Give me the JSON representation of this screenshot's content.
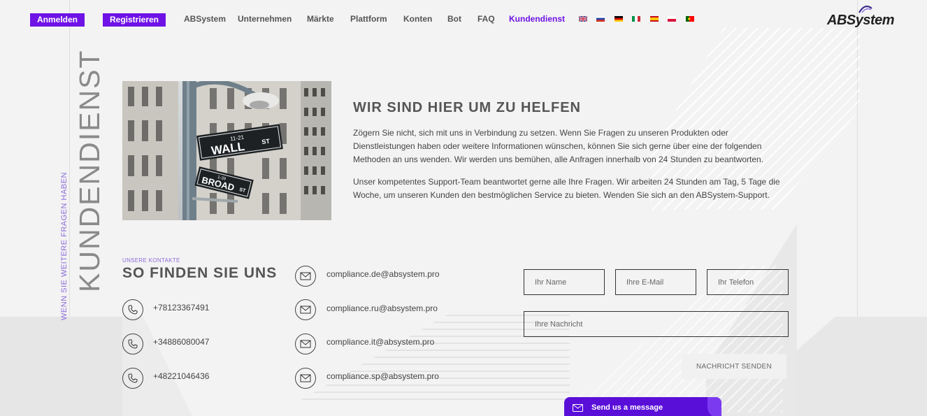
{
  "nav": {
    "login_label": "Anmelden",
    "register_label": "Registrieren",
    "links": [
      "ABSystem",
      "Unternehmen",
      "Märkte",
      "Plattform",
      "Konten",
      "Bot",
      "FAQ",
      "Kundendienst"
    ],
    "active_link": "Kundendienst",
    "languages": [
      "en",
      "ru",
      "de",
      "it",
      "es",
      "pl",
      "pt"
    ]
  },
  "logo": {
    "text": "ABSystem"
  },
  "side": {
    "title": "KUNDENDIENST",
    "subtitle": "WENN SIE WEITERE FRAGEN HABEN"
  },
  "photo": {
    "sign_top": "WALL",
    "sign_top_small": "11-21",
    "sign_st": "ST",
    "sign_bottom": "BROAD",
    "sign_bottom_small": "1-39",
    "sign_bottom_st": "ST"
  },
  "intro": {
    "title": "WIR SIND HIER UM ZU HELFEN",
    "p1": "Zögern Sie nicht, sich mit uns in Verbindung zu setzen. Wenn Sie Fragen zu unseren Produkten oder Dienstleistungen haben oder weitere Informationen wünschen, können Sie sich gerne über eine der folgenden Methoden an uns wenden. Wir werden uns bemühen, alle Anfragen innerhalb von 24 Stunden zu beantworten.",
    "p2": "Unser kompetentes Support-Team beantwortet gerne alle Ihre Fragen. Wir arbeiten 24 Stunden am Tag, 5 Tage die Woche, um unseren Kunden den bestmöglichen Service zu bieten. Wenden Sie sich an den ABSystem-Support."
  },
  "contacts": {
    "kicker": "UNSERE KONTAKTE",
    "title": "SO FINDEN SIE UNS",
    "phones": [
      "+78123367491",
      "+34886080047",
      "+48221046436"
    ],
    "emails": [
      "compliance.de@absystem.pro",
      "compliance.ru@absystem.pro",
      "compliance.it@absystem.pro",
      "compliance.sp@absystem.pro"
    ]
  },
  "form": {
    "name_placeholder": "Ihr Name",
    "email_placeholder": "Ihre E-Mail",
    "phone_placeholder": "Ihr Telefon",
    "message_placeholder": "Ihre Nachricht",
    "submit_label": "NACHRICHT SENDEN"
  },
  "chat": {
    "label": "Send us a message"
  },
  "colors": {
    "accent": "#6e12e6",
    "chat": "#5a0fd9",
    "text": "#444444"
  }
}
